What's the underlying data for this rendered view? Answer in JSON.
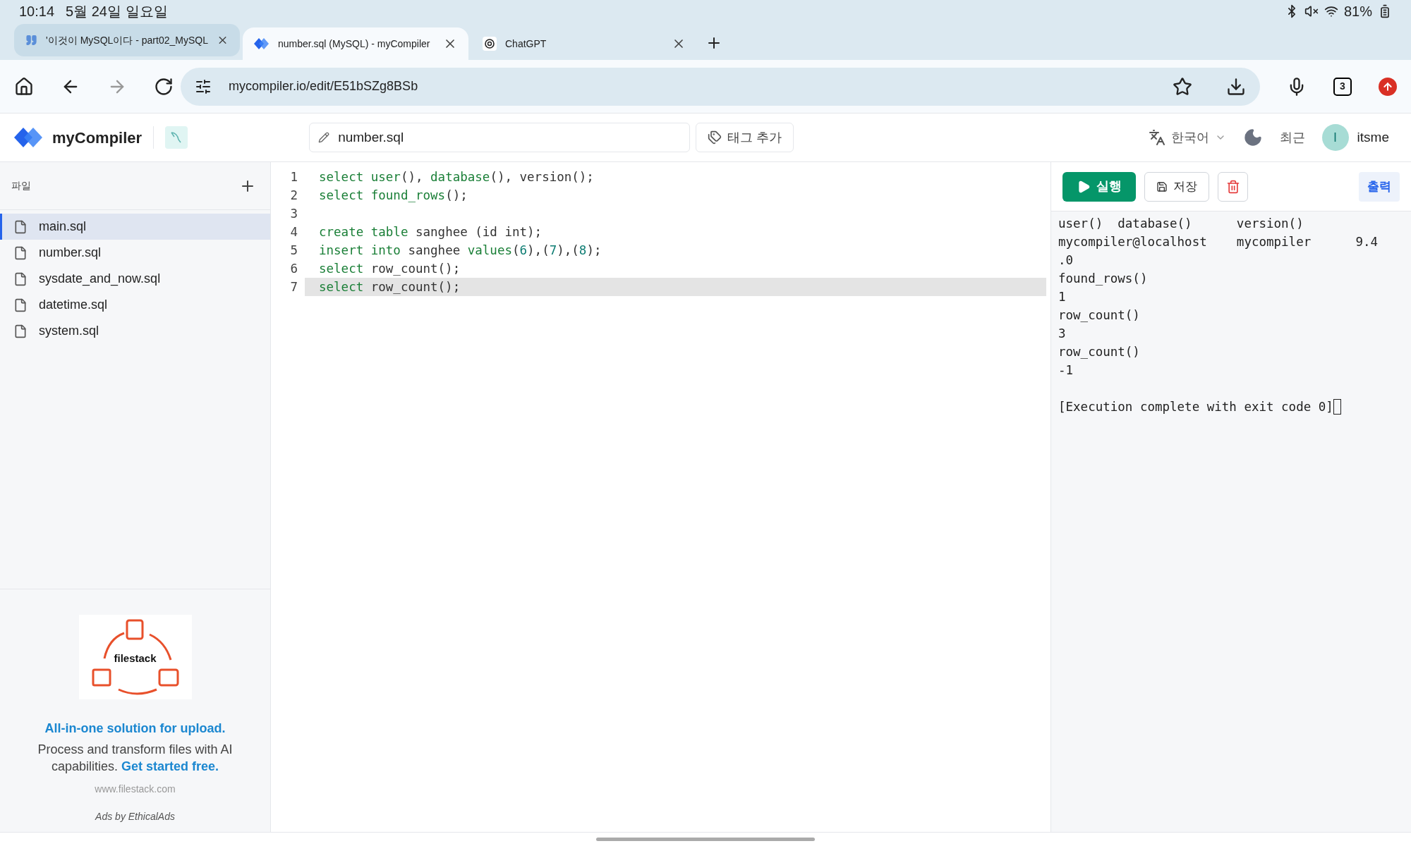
{
  "status_bar": {
    "time": "10:14",
    "date": "5월 24일 일요일",
    "battery": "81%"
  },
  "browser_tabs": [
    {
      "title": "'이것이 MySQL이다 - part02_MySQL",
      "selected": false,
      "kind": "quote"
    },
    {
      "title": "number.sql (MySQL) - myCompiler",
      "selected": true,
      "kind": "mycompiler"
    },
    {
      "title": "ChatGPT",
      "selected": false,
      "kind": "chatgpt"
    }
  ],
  "address_bar": {
    "url": "mycompiler.io/edit/E51bSZg8BSb",
    "tab_count": "3"
  },
  "header": {
    "logo": "myCompiler",
    "file_name": "number.sql",
    "tag_button": "태그 추가",
    "language": "한국어",
    "recent": "최근",
    "avatar": "I",
    "user": "itsme"
  },
  "sidebar": {
    "title": "파일",
    "files": [
      {
        "name": "main.sql",
        "selected": true
      },
      {
        "name": "number.sql",
        "selected": false
      },
      {
        "name": "sysdate_and_now.sql",
        "selected": false
      },
      {
        "name": "datetime.sql",
        "selected": false
      },
      {
        "name": "system.sql",
        "selected": false
      }
    ],
    "ad": {
      "logo": "filestack",
      "headline": "All-in-one solution for upload.",
      "body": "Process and transform files with AI capabilities.",
      "cta": "Get started free.",
      "url": "www.filestack.com",
      "credit": "Ads by EthicalAds"
    }
  },
  "editor": {
    "lines": [
      {
        "number": "1",
        "active": false,
        "tokens": [
          {
            "kind": "keyword",
            "text": "select "
          },
          {
            "kind": "keyword",
            "text": "user"
          },
          {
            "kind": "plain",
            "text": "(), "
          },
          {
            "kind": "keyword",
            "text": "database"
          },
          {
            "kind": "plain",
            "text": "(), version();"
          }
        ]
      },
      {
        "number": "2",
        "active": false,
        "tokens": [
          {
            "kind": "keyword",
            "text": "select "
          },
          {
            "kind": "keyword",
            "text": "found_rows"
          },
          {
            "kind": "plain",
            "text": "();"
          }
        ]
      },
      {
        "number": "3",
        "active": false
      },
      {
        "number": "4",
        "active": false,
        "tokens": [
          {
            "kind": "keyword",
            "text": "create "
          },
          {
            "kind": "keyword",
            "text": "table"
          },
          {
            "kind": "plain",
            "text": " sanghee (id int);"
          }
        ]
      },
      {
        "number": "5",
        "active": false,
        "tokens": [
          {
            "kind": "keyword",
            "text": "insert "
          },
          {
            "kind": "keyword",
            "text": "into"
          },
          {
            "kind": "plain",
            "text": " sanghee "
          },
          {
            "kind": "keyword",
            "text": "values"
          },
          {
            "kind": "plain",
            "text": "("
          },
          {
            "kind": "number",
            "text": "6"
          },
          {
            "kind": "plain",
            "text": "),("
          },
          {
            "kind": "number",
            "text": "7"
          },
          {
            "kind": "plain",
            "text": "),("
          },
          {
            "kind": "number",
            "text": "8"
          },
          {
            "kind": "plain",
            "text": ");"
          }
        ]
      },
      {
        "number": "6",
        "active": false,
        "tokens": [
          {
            "kind": "keyword",
            "text": "select"
          },
          {
            "kind": "plain",
            "text": " row_count();"
          }
        ]
      },
      {
        "number": "7",
        "active": true,
        "tokens": [
          {
            "kind": "keyword",
            "text": "select"
          },
          {
            "kind": "plain",
            "text": " row_count();"
          }
        ]
      }
    ]
  },
  "output": {
    "run_button": "실행",
    "save_button": "저장",
    "output_tab": "출력",
    "lines": [
      {
        "kind": "result",
        "text": "user()  database()      version()"
      },
      {
        "kind": "result",
        "text": "mycompiler@localhost    mycompiler      9.4"
      },
      {
        "kind": "result",
        "text": ".0"
      },
      {
        "kind": "result",
        "text": "found_rows()"
      },
      {
        "kind": "result",
        "text": "1"
      },
      {
        "kind": "result",
        "text": "row_count()"
      },
      {
        "kind": "result",
        "text": "3"
      },
      {
        "kind": "result",
        "text": "row_count()"
      },
      {
        "kind": "result",
        "text": "-1"
      },
      {
        "kind": "status",
        "text": "[Execution complete with exit code 0]"
      }
    ]
  }
}
